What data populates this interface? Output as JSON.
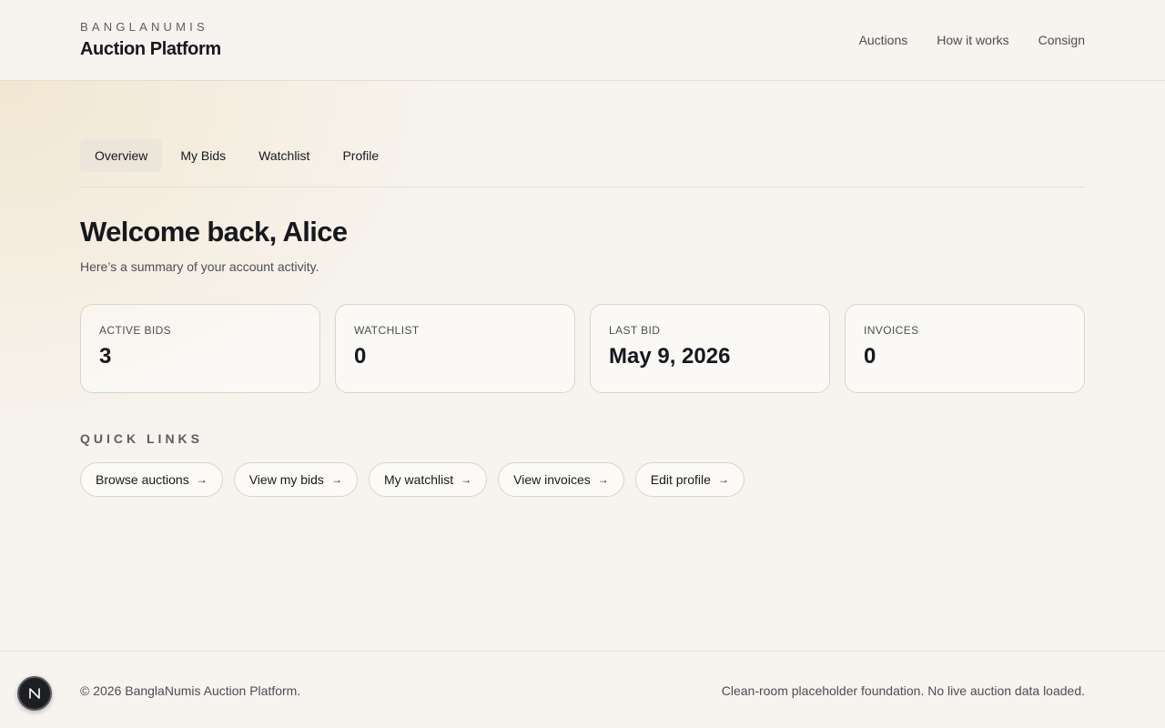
{
  "header": {
    "kicker": "BANGLANUMIS",
    "title": "Auction Platform",
    "nav": [
      "Auctions",
      "How it works",
      "Consign"
    ]
  },
  "tabs": [
    {
      "label": "Overview",
      "active": true
    },
    {
      "label": "My Bids",
      "active": false
    },
    {
      "label": "Watchlist",
      "active": false
    },
    {
      "label": "Profile",
      "active": false
    }
  ],
  "welcome": {
    "heading": "Welcome back, Alice",
    "subtitle": "Here’s a summary of your account activity."
  },
  "stats": [
    {
      "label": "ACTIVE BIDS",
      "value": "3"
    },
    {
      "label": "WATCHLIST",
      "value": "0"
    },
    {
      "label": "LAST BID",
      "value": "May 9, 2026"
    },
    {
      "label": "INVOICES",
      "value": "0"
    }
  ],
  "quick_links": {
    "title": "QUICK LINKS",
    "arrow": "→",
    "items": [
      "Browse auctions",
      "View my bids",
      "My watchlist",
      "View invoices",
      "Edit profile"
    ]
  },
  "footer": {
    "left": "© 2026 BanglaNumis Auction Platform.",
    "right": "Clean-room placeholder foundation. No live auction data loaded."
  },
  "dev_badge": {
    "icon": "n-logo-icon"
  },
  "colors": {
    "background": "#f7f4ef",
    "text": "#16181d",
    "active_tab": "#ebe5da",
    "card_border": "#ddd3c2"
  }
}
